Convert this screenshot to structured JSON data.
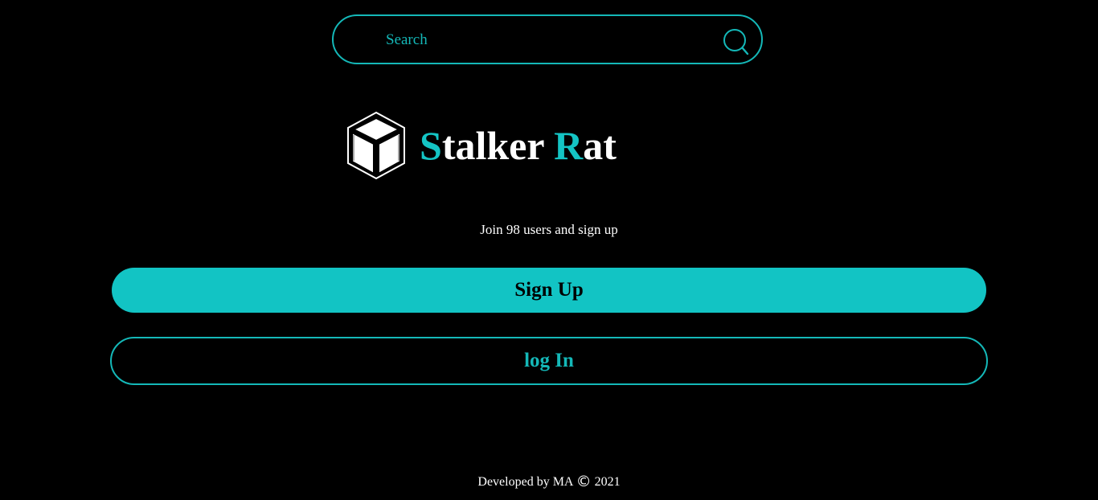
{
  "search": {
    "placeholder": "Search",
    "icon": "search-icon"
  },
  "brand": {
    "logo_icon": "cube-icon",
    "title_first_initial": "S",
    "title_first_rest": "talker ",
    "title_second_initial": "R",
    "title_second_rest": "at"
  },
  "tagline": "Join 98 users and sign up",
  "buttons": {
    "signup_label": "Sign Up",
    "login_label": "log In"
  },
  "footer": {
    "prefix": "Developed by MA ",
    "copyright_symbol": "©",
    "year": " 2021"
  },
  "colors": {
    "background": "#000000",
    "accent": "#12c4c4",
    "text": "#ffffff"
  }
}
